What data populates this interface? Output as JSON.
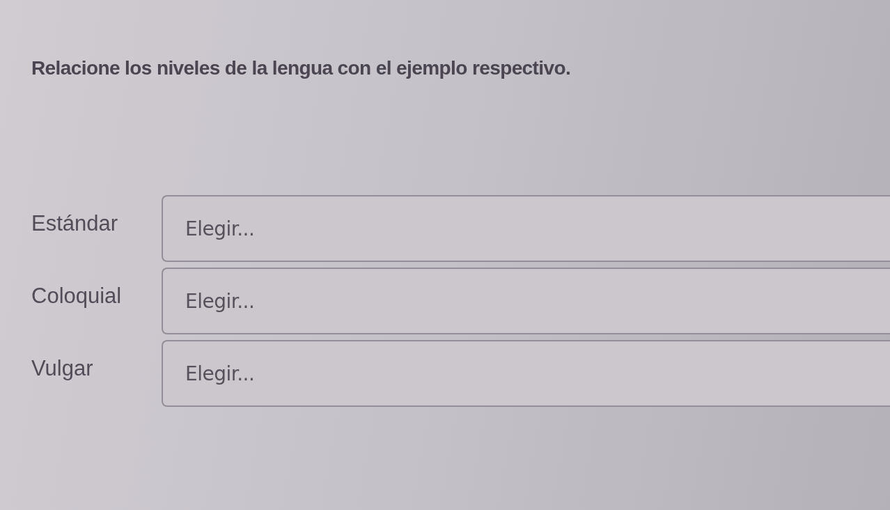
{
  "instruction": "Relacione los niveles de la lengua con el ejemplo respectivo.",
  "matches": [
    {
      "label": "Estándar",
      "value": "Elegir..."
    },
    {
      "label": "Coloquial",
      "value": "Elegir..."
    },
    {
      "label": "Vulgar",
      "value": "Elegir..."
    }
  ]
}
